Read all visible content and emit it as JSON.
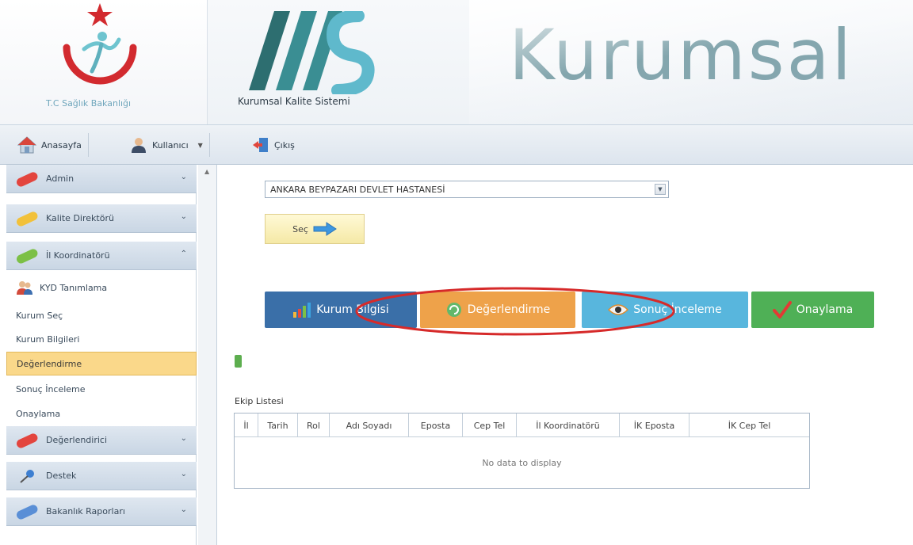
{
  "header": {
    "ministry_name": "T.C Sağlık Bakanlığı",
    "system_name": "Kurumsal Kalite Sistemi",
    "brand_title": "Kurumsal"
  },
  "toolbar": {
    "home_label": "Anasayfa",
    "user_label": "Kullanıcı",
    "logout_label": "Çıkış"
  },
  "sidebar": {
    "groups": [
      {
        "label": "Admin",
        "icon": "red-pill-icon",
        "color": "#e3453e"
      },
      {
        "label": "Kalite Direktörü",
        "icon": "yellow-pill-icon",
        "color": "#f2c13a"
      },
      {
        "label": "İl Koordinatörü",
        "icon": "green-pill-icon",
        "color": "#7cc046"
      },
      {
        "label": "Değerlendirici",
        "icon": "red-pill-icon",
        "color": "#e3453e"
      },
      {
        "label": "Destek",
        "icon": "pin-icon",
        "color": "#3d7fd1"
      },
      {
        "label": "Bakanlık Raporları",
        "icon": "blue-pill-icon",
        "color": "#5a8fd6"
      }
    ],
    "items": [
      {
        "label": "KYD Tanımlama"
      },
      {
        "label": "Kurum Seç"
      },
      {
        "label": "Kurum Bilgileri"
      },
      {
        "label": "Değerlendirme"
      },
      {
        "label": "Sonuç İnceleme"
      },
      {
        "label": "Onaylama"
      }
    ]
  },
  "main": {
    "hospital_value": "ANKARA BEYPAZARI DEVLET HASTANESİ",
    "select_button_label": "Seç",
    "steps": [
      {
        "label": "Kurum Bilgisi",
        "color": "#3a6fa8"
      },
      {
        "label": "Değerlendirme",
        "color": "#eea24a"
      },
      {
        "label": "Sonuç İnceleme",
        "color": "#58b6dd"
      },
      {
        "label": "Onaylama",
        "color": "#4fb056"
      }
    ],
    "team_list_label": "Ekip Listesi",
    "table": {
      "columns": [
        "İl",
        "Tarih",
        "Rol",
        "Adı Soyadı",
        "Eposta",
        "Cep Tel",
        "İl Koordinatörü",
        "İK Eposta",
        "İK Cep Tel"
      ],
      "empty_text": "No data to display"
    }
  }
}
